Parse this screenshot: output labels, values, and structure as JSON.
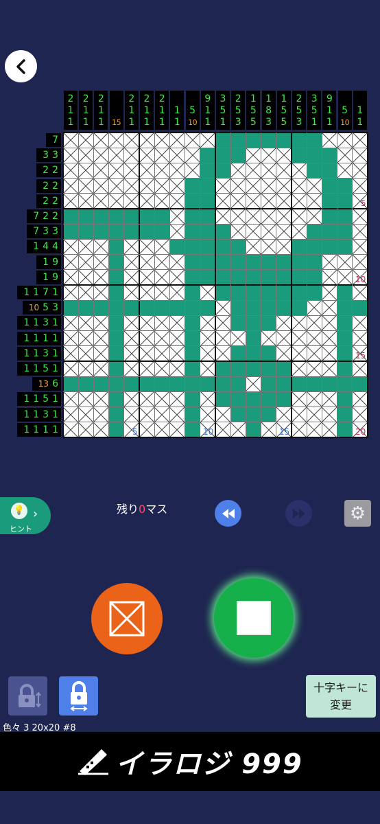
{
  "puzzle": {
    "remaining_prefix": "残り",
    "remaining_count": "0",
    "remaining_suffix": "マス",
    "info": "色々 3  20x20  #8",
    "col_clues": [
      [
        "2",
        "1",
        "1"
      ],
      [
        "2",
        "1",
        "1"
      ],
      [
        "2",
        "1",
        "1"
      ],
      [
        "15"
      ],
      [
        "2",
        "1",
        "1"
      ],
      [
        "2",
        "1",
        "1"
      ],
      [
        "2",
        "1",
        "1"
      ],
      [
        "1",
        "1"
      ],
      [
        "5",
        "10"
      ],
      [
        "9",
        "1",
        "1"
      ],
      [
        "3",
        "5",
        "1"
      ],
      [
        "2",
        "5",
        "3"
      ],
      [
        "1",
        "5",
        "5"
      ],
      [
        "1",
        "8",
        "3"
      ],
      [
        "1",
        "5",
        "5"
      ],
      [
        "2",
        "5",
        "3"
      ],
      [
        "3",
        "5",
        "1"
      ],
      [
        "9",
        "1",
        "1"
      ],
      [
        "5",
        "10"
      ],
      [
        "1",
        "1"
      ]
    ],
    "row_clues": [
      [
        "7"
      ],
      [
        "3",
        "3"
      ],
      [
        "2",
        "2"
      ],
      [
        "2",
        "2"
      ],
      [
        "2",
        "2"
      ],
      [
        "7",
        "2",
        "2"
      ],
      [
        "7",
        "3",
        "3"
      ],
      [
        "1",
        "4",
        "4"
      ],
      [
        "1",
        "9"
      ],
      [
        "1",
        "9"
      ],
      [
        "1",
        "1",
        "7",
        "1"
      ],
      [
        "10",
        "5",
        "3"
      ],
      [
        "1",
        "1",
        "3",
        "1"
      ],
      [
        "1",
        "1",
        "1",
        "1"
      ],
      [
        "1",
        "1",
        "3",
        "1"
      ],
      [
        "1",
        "1",
        "5",
        "1"
      ],
      [
        "13",
        "6"
      ],
      [
        "1",
        "1",
        "5",
        "1"
      ],
      [
        "1",
        "1",
        "3",
        "1"
      ],
      [
        "1",
        "1",
        "1",
        "1"
      ]
    ],
    "grid_rows": [
      "XXXXXXXXXXFFFFFFFXXX",
      "XXXXXXXXXFFFXXXFFFXX",
      "XXXXXXXXXFFXXXXXFFXX",
      "XXXXXXXXFFXXXXXXXFFX",
      "XXXXXXXXFFXXXXXXXFFX",
      "FFFFFFFXFFXXXXXXXFFX",
      "FFFFFFFXFFFXXXXXFFFX",
      "XXXFXXXFFFFFXXXFFFFX",
      "XXXFXXXXFFFFFFFFFXXX",
      "XXXFXXXXFFFFFFFFFXXX",
      "XXXFXXXXFXFFFFFFFXFX",
      "FFFFFFFFFFXFFFFFXXFF",
      "XXXFXXXXFXXFFFXXXXFX",
      "XXXFXXXXFXXXFXXXXXFX",
      "XXXFXXXXFXXFFFXXXXFX",
      "XXXFXXXXFXFFFFFXXXFX",
      "FFFFFFFFFFFFXFFFFFFF",
      "XXXFXXXXFXFFFFFXXXFX",
      "XXXFXXXXFXXFFFXXXXFX",
      "XXXFXXXXFXXXFXXXXXFX"
    ],
    "grid_numbers": {
      "col5": "5",
      "col10": "10",
      "col15": "15",
      "col20": "20",
      "row5": "5",
      "row10": "10",
      "row15": "15",
      "row20": "20"
    }
  },
  "controls": {
    "hint_label": "ヒント",
    "dpad_line1": "十字キーに",
    "dpad_line2": "変更"
  },
  "banner": {
    "title": "イラロジ 999"
  },
  "colors": {
    "background": "#1e2550",
    "fill": "#1a9c7c",
    "x_button": "#eb6319",
    "fill_button": "#15b04a",
    "undo": "#4f7fe8"
  }
}
